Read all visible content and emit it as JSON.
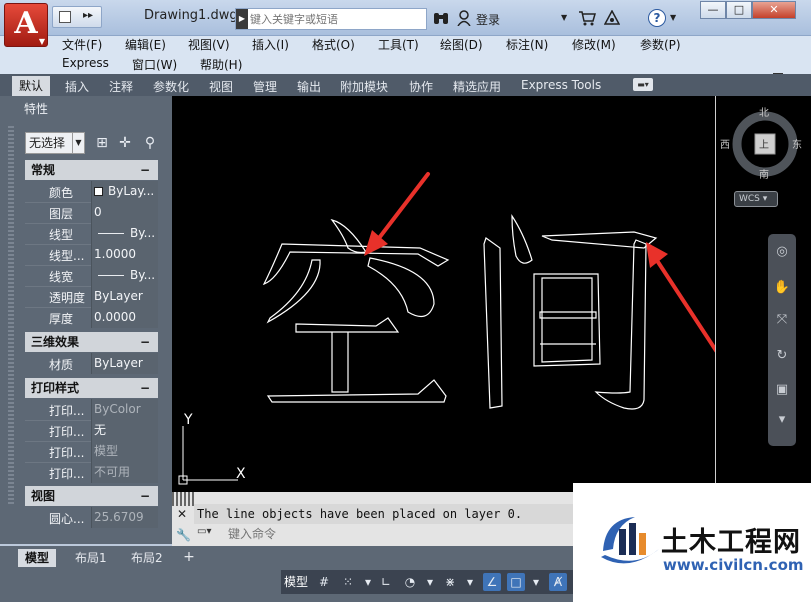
{
  "window": {
    "doc_title": "Drawing1.dwg",
    "search_placeholder": "键入关键字或短语",
    "login_label": "登录",
    "minimize": "—",
    "maximize": "□",
    "close": "✕"
  },
  "menus": [
    {
      "label": "文件(F)"
    },
    {
      "label": "编辑(E)"
    },
    {
      "label": "视图(V)"
    },
    {
      "label": "插入(I)"
    },
    {
      "label": "格式(O)"
    },
    {
      "label": "工具(T)"
    },
    {
      "label": "绘图(D)"
    },
    {
      "label": "标注(N)"
    },
    {
      "label": "修改(M)"
    },
    {
      "label": "参数(P)"
    },
    {
      "label": "Express"
    },
    {
      "label": "窗口(W)"
    },
    {
      "label": "帮助(H)"
    }
  ],
  "ribbon_tabs": [
    "默认",
    "插入",
    "注释",
    "参数化",
    "视图",
    "管理",
    "输出",
    "附加模块",
    "协作",
    "精选应用",
    "Express Tools"
  ],
  "properties": {
    "title": "特性",
    "selection": "无选择",
    "sections": [
      {
        "title": "常规",
        "rows": [
          {
            "label": "颜色",
            "value": "ByLay..."
          },
          {
            "label": "图层",
            "value": "0"
          },
          {
            "label": "线型",
            "value": "By..."
          },
          {
            "label": "线型...",
            "value": "1.0000"
          },
          {
            "label": "线宽",
            "value": "By..."
          },
          {
            "label": "透明度",
            "value": "ByLayer"
          },
          {
            "label": "厚度",
            "value": "0.0000"
          }
        ]
      },
      {
        "title": "三维效果",
        "rows": [
          {
            "label": "材质",
            "value": "ByLayer"
          }
        ]
      },
      {
        "title": "打印样式",
        "rows": [
          {
            "label": "打印...",
            "value": "ByColor"
          },
          {
            "label": "打印...",
            "value": "无"
          },
          {
            "label": "打印...",
            "value": "模型"
          },
          {
            "label": "打印...",
            "value": "不可用"
          }
        ]
      },
      {
        "title": "视图",
        "rows": [
          {
            "label": "圆心...",
            "value": "25.6709"
          }
        ]
      }
    ]
  },
  "viewcube": {
    "north": "北",
    "south": "南",
    "east": "东",
    "west": "西",
    "face": "上",
    "wcs": "WCS"
  },
  "ucs": {
    "x": "X",
    "y": "Y"
  },
  "command": {
    "history": "The line objects have been placed on layer 0.",
    "placeholder": "键入命令"
  },
  "layout_tabs": [
    "模型",
    "布局1",
    "布局2"
  ],
  "status": {
    "model": "模型"
  },
  "watermark": {
    "title": "土木工程网",
    "url": "www.civilcn.com"
  },
  "colors": {
    "canvas": "#000000",
    "arrow": "#e8312a",
    "palette": "#5d6875"
  }
}
